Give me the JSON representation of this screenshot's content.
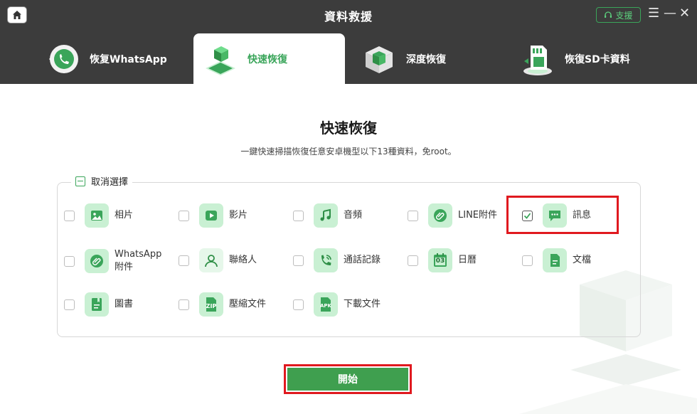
{
  "app": {
    "title": "資料救援",
    "support_label": "支援"
  },
  "tabs": [
    {
      "label": "恢复WhatsApp",
      "active": false,
      "icon": "whatsapp-phone-icon"
    },
    {
      "label": "快速恢復",
      "active": true,
      "icon": "quick-recover-cube-icon"
    },
    {
      "label": "深度恢復",
      "active": false,
      "icon": "deep-recover-cube-icon"
    },
    {
      "label": "恢復SD卡資料",
      "active": false,
      "icon": "sd-card-icon"
    }
  ],
  "main": {
    "heading": "快速恢復",
    "subtitle": "一鍵快速掃描恢復任意安卓機型以下13種資料，免root。",
    "deselect_label": "取消選擇",
    "start_label": "開始"
  },
  "items": [
    {
      "label": "相片",
      "checked": false,
      "icon": "photo-icon"
    },
    {
      "label": "影片",
      "checked": false,
      "icon": "video-icon"
    },
    {
      "label": "音頻",
      "checked": false,
      "icon": "music-icon"
    },
    {
      "label": "LINE附件",
      "checked": false,
      "icon": "attachment-icon"
    },
    {
      "label": "訊息",
      "checked": true,
      "icon": "message-icon"
    },
    {
      "label": "WhatsApp",
      "label2": "附件",
      "checked": false,
      "icon": "whatsapp-attachment-icon"
    },
    {
      "label": "聯絡人",
      "checked": false,
      "icon": "contact-icon"
    },
    {
      "label": "通話記錄",
      "checked": false,
      "icon": "call-log-icon"
    },
    {
      "label": "日曆",
      "checked": false,
      "icon": "calendar-icon",
      "calendar_day": "03"
    },
    {
      "label": "文檔",
      "checked": false,
      "icon": "document-icon"
    },
    {
      "label": "圖書",
      "checked": false,
      "icon": "book-icon"
    },
    {
      "label": "壓縮文件",
      "checked": false,
      "icon": "zip-icon",
      "badge": "ZIP"
    },
    {
      "label": "下載文件",
      "checked": false,
      "icon": "apk-icon",
      "badge": "APK"
    }
  ],
  "colors": {
    "accent": "#3aa55a",
    "header_bg": "#3c3c3c",
    "highlight": "#e0191f"
  }
}
